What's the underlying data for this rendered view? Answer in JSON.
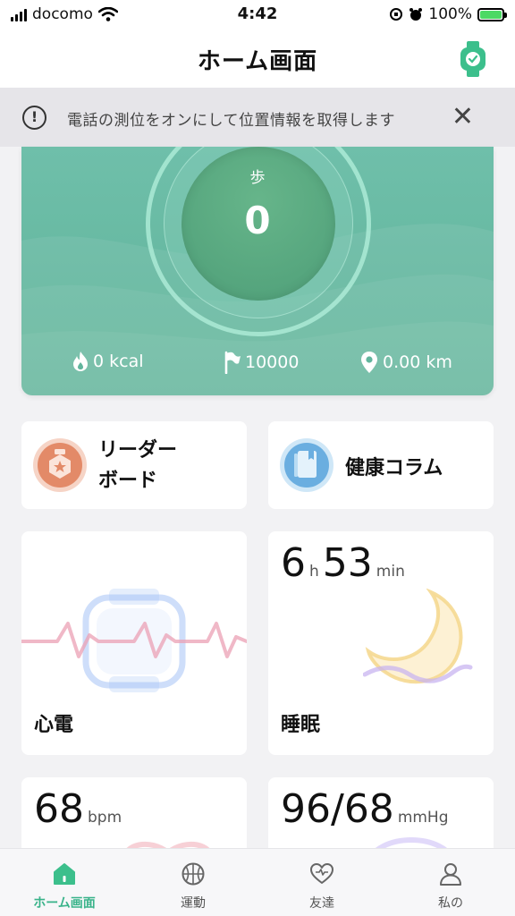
{
  "status_bar": {
    "carrier": "docomo",
    "time": "4:42",
    "battery_percent": "100%"
  },
  "header": {
    "title": "ホーム画面"
  },
  "banner": {
    "text": "電話の測位をオンにして位置情報を取得します",
    "info_glyph": "!",
    "close_glyph": "✕"
  },
  "steps": {
    "label": "歩",
    "value": "0",
    "calories": "0 kcal",
    "goal": "10000",
    "distance": "0.00 km"
  },
  "tiles": {
    "leaderboard": {
      "line1": "リーダー",
      "line2": "ボード"
    },
    "health_column": {
      "label": "健康コラム"
    },
    "ecg": {
      "label": "心電"
    },
    "sleep": {
      "label": "睡眠",
      "hours": "6",
      "hours_unit": "h",
      "minutes": "53",
      "minutes_unit": "min"
    },
    "heart_rate": {
      "value": "68",
      "unit": "bpm"
    },
    "blood_pressure": {
      "value": "96/68",
      "unit": "mmHg"
    }
  },
  "tabbar": {
    "items": [
      {
        "label": "ホーム画面",
        "icon": "home-icon",
        "active": true
      },
      {
        "label": "運動",
        "icon": "basketball-icon",
        "active": false
      },
      {
        "label": "友達",
        "icon": "heart-icon",
        "active": false
      },
      {
        "label": "私の",
        "icon": "person-icon",
        "active": false
      }
    ]
  },
  "colors": {
    "accent": "#39b38a",
    "card_green": "#66b9a2",
    "banner_bg": "#e6e5e9"
  }
}
